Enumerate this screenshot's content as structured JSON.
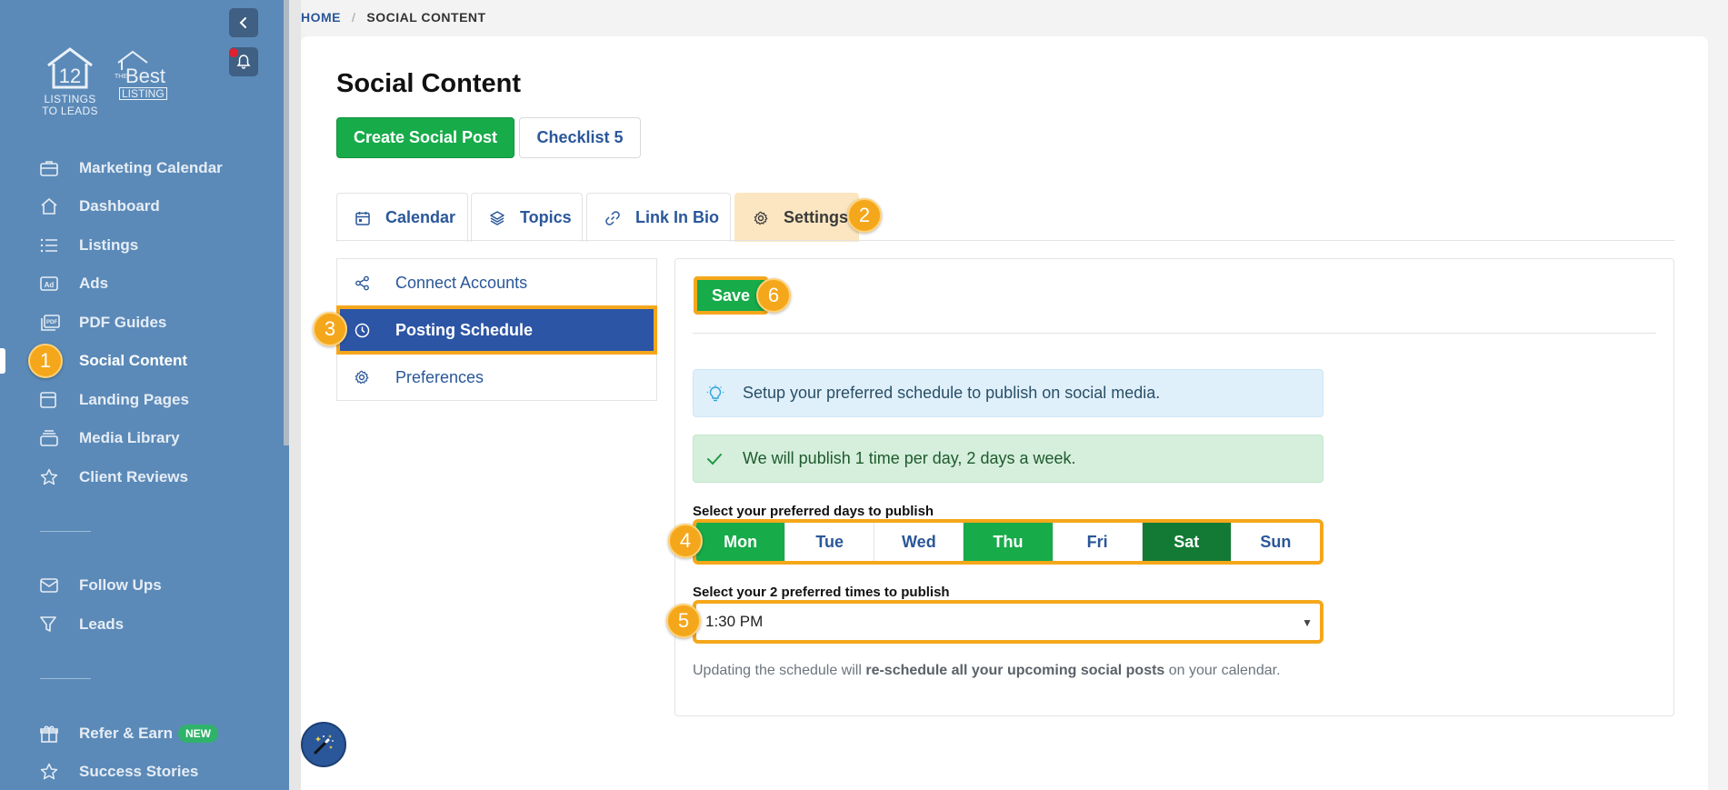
{
  "breadcrumb": {
    "home": "HOME",
    "separator": "/",
    "current": "SOCIAL CONTENT"
  },
  "logo": {
    "primary_number": "12",
    "primary_line1": "LISTINGS",
    "primary_line2": "TO LEADS",
    "secondary_the": "THE",
    "secondary_best": "Best",
    "secondary_listing": "LISTING"
  },
  "sidebar": {
    "items": [
      {
        "label": "Marketing Calendar",
        "icon": "briefcase-icon"
      },
      {
        "label": "Dashboard",
        "icon": "home-icon"
      },
      {
        "label": "Listings",
        "icon": "list-icon"
      },
      {
        "label": "Ads",
        "icon": "ad-icon"
      },
      {
        "label": "PDF Guides",
        "icon": "pdf-icon"
      },
      {
        "label": "Social Content",
        "icon": "",
        "active": true
      },
      {
        "label": "Landing Pages",
        "icon": "page-icon"
      },
      {
        "label": "Media Library",
        "icon": "stack-icon"
      },
      {
        "label": "Client Reviews",
        "icon": "star-icon"
      },
      {
        "label": "Follow Ups",
        "icon": "mail-icon"
      },
      {
        "label": "Leads",
        "icon": "filter-icon"
      },
      {
        "label": "Refer & Earn",
        "icon": "gift-icon",
        "badge": "NEW"
      },
      {
        "label": "Success Stories",
        "icon": "star-icon"
      }
    ]
  },
  "markers": [
    "1",
    "2",
    "3",
    "4",
    "5",
    "6"
  ],
  "page": {
    "title": "Social Content",
    "create_button": "Create Social Post",
    "checklist_button": "Checklist 5"
  },
  "tabs": [
    {
      "label": "Calendar",
      "icon": "calendar-icon"
    },
    {
      "label": "Topics",
      "icon": "layers-icon"
    },
    {
      "label": "Link In Bio",
      "icon": "link-icon"
    },
    {
      "label": "Settings",
      "icon": "gear-icon",
      "active": true
    }
  ],
  "submenu": [
    {
      "label": "Connect Accounts",
      "icon": "share-icon"
    },
    {
      "label": "Posting Schedule",
      "icon": "clock-icon",
      "active": true
    },
    {
      "label": "Preferences",
      "icon": "gear-icon"
    }
  ],
  "settings": {
    "save_button": "Save",
    "info_alert": "Setup your preferred schedule to publish on social media.",
    "success_alert": "We will publish 1 time per day, 2 days a week.",
    "days_label": "Select your preferred days to publish",
    "days": [
      {
        "label": "Mon",
        "selected": true
      },
      {
        "label": "Tue",
        "selected": false
      },
      {
        "label": "Wed",
        "selected": false
      },
      {
        "label": "Thu",
        "selected": true
      },
      {
        "label": "Fri",
        "selected": false
      },
      {
        "label": "Sat",
        "selected": true
      },
      {
        "label": "Sun",
        "selected": false
      }
    ],
    "times_label": "Select your 2 preferred times to publish",
    "time_value": "1:30 PM",
    "note_prefix": "Updating the schedule will ",
    "note_bold": "re-schedule all your upcoming social posts",
    "note_suffix": " on your calendar."
  },
  "colors": {
    "sidebar_bg": "#5b8ab8",
    "accent_green": "#17ab4a",
    "accent_blue": "#2a5799",
    "marker_orange": "#f5a71b",
    "tab_active_bg": "#fce6c1"
  }
}
